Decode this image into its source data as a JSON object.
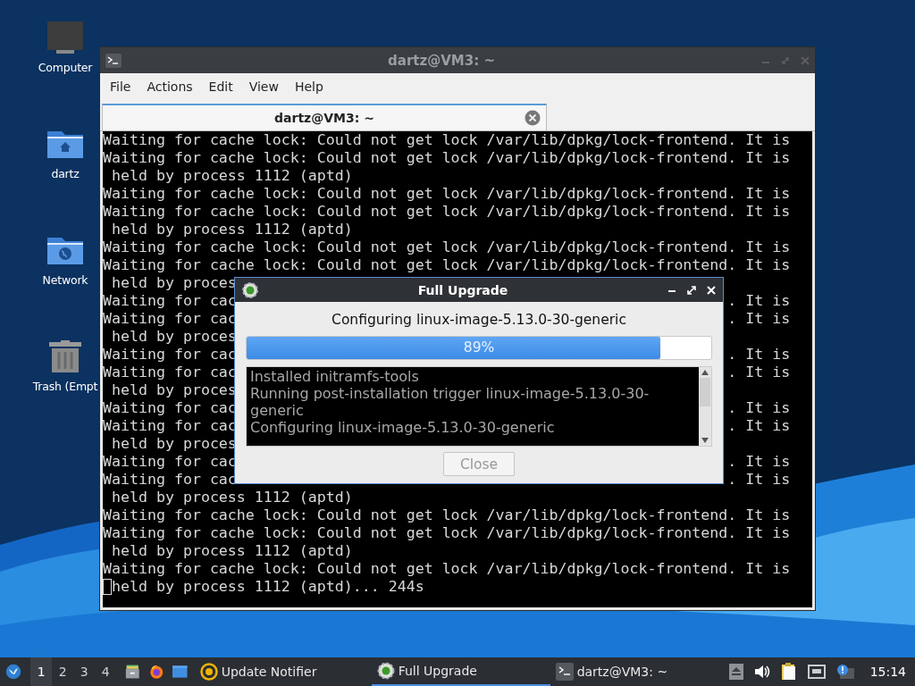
{
  "desktop_icons": [
    {
      "label": "Computer",
      "kind": "computer"
    },
    {
      "label": "dartz",
      "kind": "home"
    },
    {
      "label": "Network",
      "kind": "network"
    },
    {
      "label": "Trash (Empt",
      "kind": "trash"
    }
  ],
  "terminal": {
    "title": "dartz@VM3: ~",
    "menu": [
      "File",
      "Actions",
      "Edit",
      "View",
      "Help"
    ],
    "tabs": [
      {
        "title": "dartz@VM3: ~",
        "selected": true
      }
    ],
    "lines": [
      {
        "kind": "full",
        "text": "Waiting for cache lock: Could not get lock /var/lib/dpkg/lock-frontend. It is"
      },
      {
        "kind": "full",
        "text": "Waiting for cache lock: Could not get lock /var/lib/dpkg/lock-frontend. It is"
      },
      {
        "kind": "full",
        "text": " held by process 1112 (aptd)"
      },
      {
        "kind": "full",
        "text": "Waiting for cache lock: Could not get lock /var/lib/dpkg/lock-frontend. It is"
      },
      {
        "kind": "full",
        "text": "Waiting for cache lock: Could not get lock /var/lib/dpkg/lock-frontend. It is"
      },
      {
        "kind": "full",
        "text": " held by process 1112 (aptd)"
      },
      {
        "kind": "full",
        "text": "Waiting for cache lock: Could not get lock /var/lib/dpkg/lock-frontend. It is"
      },
      {
        "kind": "full",
        "text": "Waiting for cache lock: Could not get lock /var/lib/dpkg/lock-frontend. It is"
      },
      {
        "kind": "covered",
        "left": " held by proces"
      },
      {
        "kind": "covered",
        "left": "Waiting for cac",
        "right": ". It is"
      },
      {
        "kind": "covered",
        "left": "Waiting for cac",
        "right": ". It is"
      },
      {
        "kind": "covered",
        "left": " held by proces"
      },
      {
        "kind": "covered",
        "left": "Waiting for cac",
        "right": ". It is"
      },
      {
        "kind": "covered",
        "left": "Waiting for cac",
        "right": ". It is"
      },
      {
        "kind": "covered",
        "left": " held by proces"
      },
      {
        "kind": "covered",
        "left": "Waiting for cac",
        "right": ". It is"
      },
      {
        "kind": "covered",
        "left": "Waiting for cac",
        "right": ". It is"
      },
      {
        "kind": "covered",
        "left": " held by proces"
      },
      {
        "kind": "covered",
        "left": "Waiting for cac",
        "right": ". It is"
      },
      {
        "kind": "covered",
        "left": "Waiting for cac",
        "right": ". It is"
      },
      {
        "kind": "full",
        "text": " held by process 1112 (aptd)"
      },
      {
        "kind": "full",
        "text": "Waiting for cache lock: Could not get lock /var/lib/dpkg/lock-frontend. It is"
      },
      {
        "kind": "full",
        "text": "Waiting for cache lock: Could not get lock /var/lib/dpkg/lock-frontend. It is"
      },
      {
        "kind": "full",
        "text": " held by process 1112 (aptd)"
      },
      {
        "kind": "full",
        "text": "Waiting for cache lock: Could not get lock /var/lib/dpkg/lock-frontend. It is"
      },
      {
        "kind": "full",
        "text": "held by process 1112 (aptd)... 244s",
        "cursor": true
      }
    ]
  },
  "dialog": {
    "title": "Full Upgrade",
    "status": "Configuring linux-image-5.13.0-30-generic",
    "progress": {
      "level": 0.89,
      "label": "89%"
    },
    "log": [
      "Installed initramfs-tools",
      "Running post-installation trigger linux-image-5.13.0-30-generic",
      "Configuring linux-image-5.13.0-30-generic"
    ],
    "buttons": [
      {
        "label": "Close",
        "disabled": true
      }
    ]
  },
  "taskbar": {
    "workspaces": [
      {
        "label": "1",
        "selected": true
      },
      {
        "label": "2",
        "selected": false
      },
      {
        "label": "3",
        "selected": false
      },
      {
        "label": "4",
        "selected": false
      }
    ],
    "tasks": [
      {
        "label": "Update Notifier",
        "kind": "notifier",
        "selected": false
      },
      {
        "label": "Full Upgrade",
        "kind": "upgrade",
        "selected": true
      },
      {
        "label": "dartz@VM3: ~",
        "kind": "terminal",
        "selected": false
      }
    ],
    "clock": "15:14"
  }
}
